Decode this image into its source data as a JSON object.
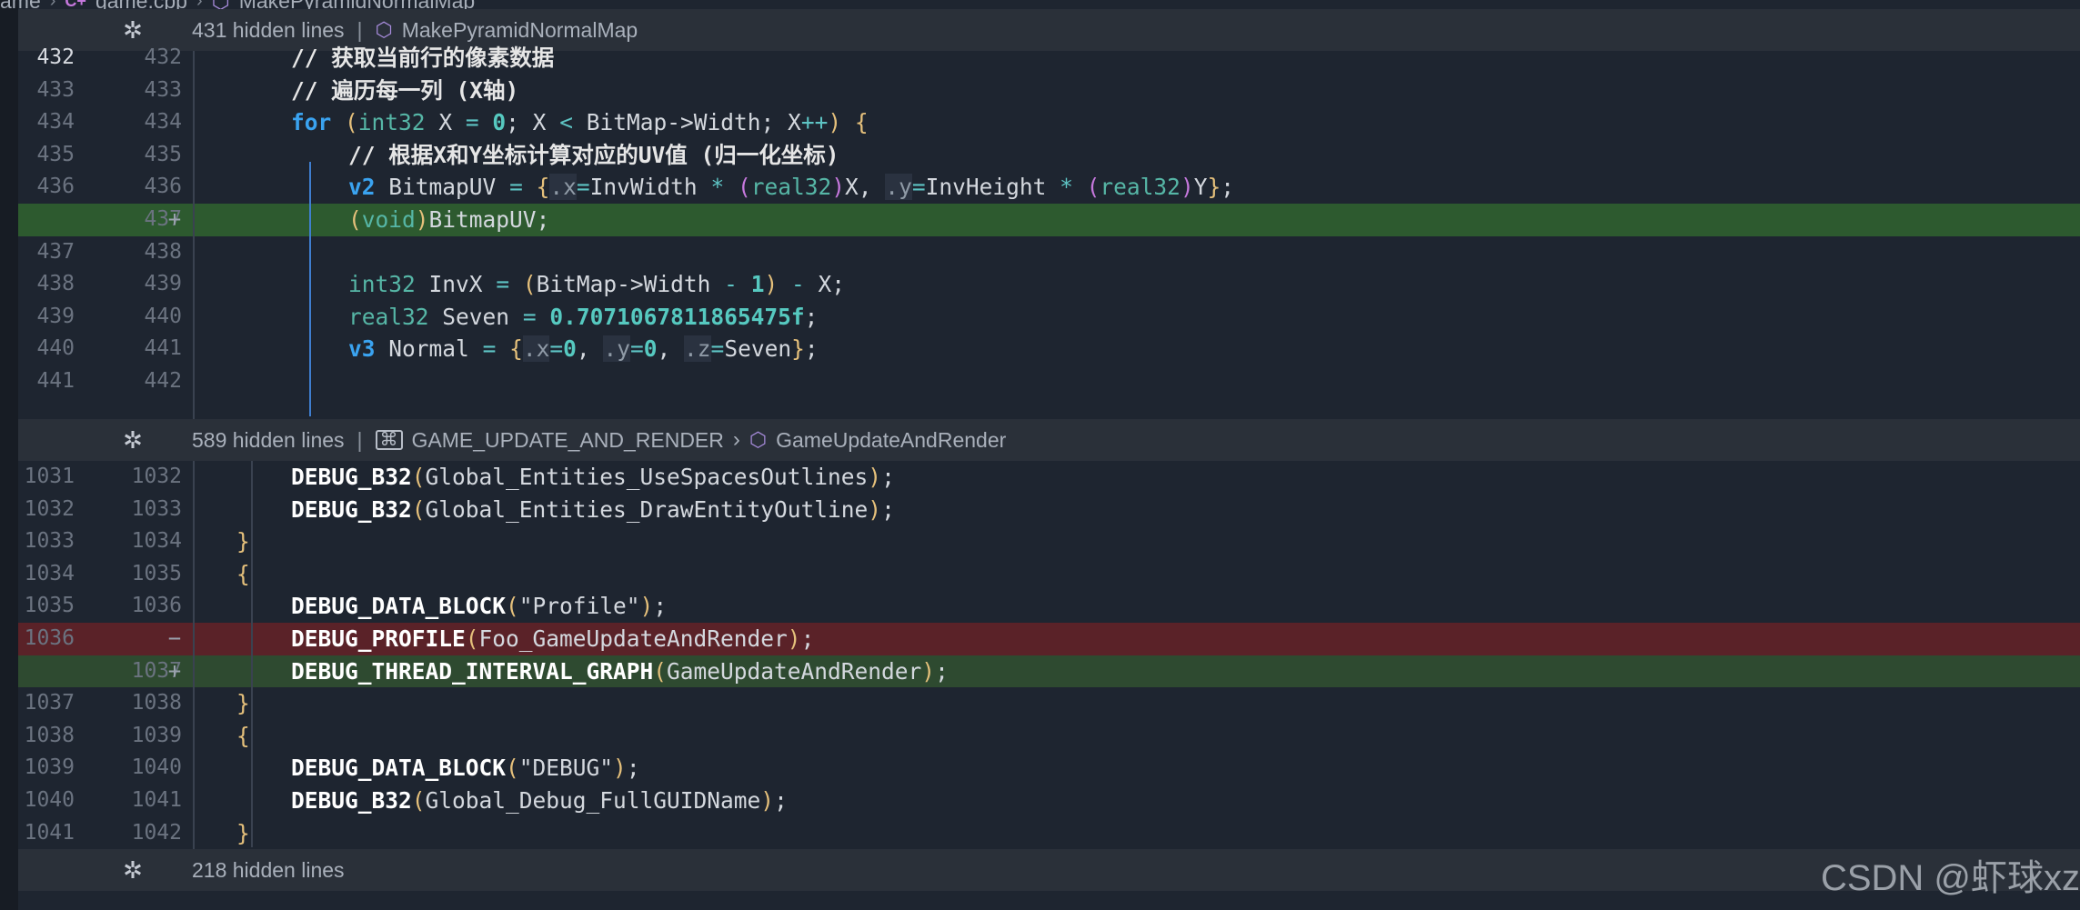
{
  "breadcrumb": {
    "items": [
      "ame",
      "game.cpp",
      "MakePyramidNormalMap"
    ]
  },
  "folds": [
    {
      "hidden": "431 hidden lines",
      "symbols": [
        "MakePyramidNormalMap"
      ]
    },
    {
      "hidden": "589 hidden lines",
      "symbols": [
        "GAME_UPDATE_AND_RENDER",
        "GameUpdateAndRender"
      ]
    },
    {
      "hidden": "218 hidden lines",
      "symbols": []
    }
  ],
  "section1": [
    {
      "old": "432",
      "new": "432",
      "code": "// 获取当前行的像素数据"
    },
    {
      "old": "433",
      "new": "433",
      "code": "// 遍历每一列 (X轴)"
    },
    {
      "old": "434",
      "new": "434",
      "code": "for (int32 X = 0; X < BitMap->Width; X++) {"
    },
    {
      "old": "435",
      "new": "435",
      "code": "// 根据X和Y坐标计算对应的UV值 (归一化坐标)"
    },
    {
      "old": "436",
      "new": "436",
      "code": "v2 BitmapUV = {.x=InvWidth * (real32)X, .y=InvHeight * (real32)Y};"
    },
    {
      "old": "",
      "new": "437",
      "mark": "+",
      "code": "(void)BitmapUV;"
    },
    {
      "old": "437",
      "new": "438",
      "code": ""
    },
    {
      "old": "438",
      "new": "439",
      "code": "int32 InvX = (BitMap->Width - 1) - X;"
    },
    {
      "old": "439",
      "new": "440",
      "code": "real32 Seven = 0.7071067811865475f;"
    },
    {
      "old": "440",
      "new": "441",
      "code": "v3 Normal = {.x=0, .y=0, .z=Seven};"
    },
    {
      "old": "441",
      "new": "442",
      "code": ""
    }
  ],
  "section2": [
    {
      "old": "1031",
      "new": "1032",
      "code": "DEBUG_B32(Global_Entities_UseSpacesOutlines);"
    },
    {
      "old": "1032",
      "new": "1033",
      "code": "DEBUG_B32(Global_Entities_DrawEntityOutline);"
    },
    {
      "old": "1033",
      "new": "1034",
      "code": "}"
    },
    {
      "old": "1034",
      "new": "1035",
      "code": "{"
    },
    {
      "old": "1035",
      "new": "1036",
      "code": "DEBUG_DATA_BLOCK(\"Profile\");"
    },
    {
      "old": "1036",
      "new": "",
      "mark": "−",
      "code": "DEBUG_PROFILE(Foo_GameUpdateAndRender);"
    },
    {
      "old": "",
      "new": "1037",
      "mark": "+",
      "code": "DEBUG_THREAD_INTERVAL_GRAPH(GameUpdateAndRender);"
    },
    {
      "old": "1037",
      "new": "1038",
      "code": "}"
    },
    {
      "old": "1038",
      "new": "1039",
      "code": "{"
    },
    {
      "old": "1039",
      "new": "1040",
      "code": "DEBUG_DATA_BLOCK(\"DEBUG\");"
    },
    {
      "old": "1040",
      "new": "1041",
      "code": "DEBUG_B32(Global_Debug_FullGUIDName);"
    },
    {
      "old": "1041",
      "new": "1042",
      "code": "}"
    }
  ],
  "watermark": "CSDN @虾球xz",
  "colors": {
    "background": "#1e2530",
    "added_line": "#2d5a2f",
    "removed_line": "#5a2228",
    "keyword": "#3aa3f0"
  }
}
